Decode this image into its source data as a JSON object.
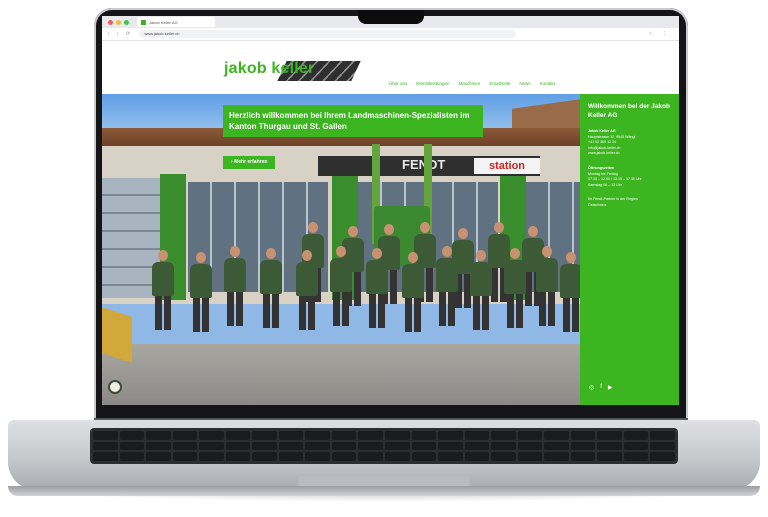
{
  "browser": {
    "tab_title": "Jakob Keller AG",
    "url": "www.jakob-keller.ch",
    "nav_glyphs": "‹ › ⟳",
    "tool_glyphs": "☆ ⋮"
  },
  "logo": {
    "text": "jakob keller"
  },
  "menu": {
    "items": [
      "Über uns",
      "Dienstleistungen",
      "Maschinen",
      "Ersatzteile",
      "News",
      "Kontakt"
    ]
  },
  "hero": {
    "title": "Herzlich willkommen bei Ihrem Landmaschinen-Spezialisten im Kanton Thurgau und St. Gallen",
    "button_label": "Mehr erfahren",
    "sign_brand": "FENDT",
    "sign_station": "station"
  },
  "side_panel": {
    "heading": "Willkommen bei der Jakob Keller AG",
    "contact_title": "Jakob Keller AG",
    "contact_lines": [
      "Hauptstrasse 12, 9545 Wängi",
      "+41 52 369 12 34",
      "info@jakob-keller.ch",
      "www.jakob-keller.ch"
    ],
    "hours_title": "Öffnungszeiten",
    "hours_lines": [
      "Montag bis Freitag",
      "07.30 – 12.00 / 13.15 – 17.30 Uhr",
      "Samstag 08 – 12 Uhr"
    ],
    "note_lines": [
      "Ihr Fendt-Partner in der Region",
      "Ostschweiz"
    ],
    "social_icons": [
      "instagram-icon",
      "facebook-icon",
      "youtube-icon"
    ]
  },
  "colors": {
    "brand_green": "#3cb520",
    "text_on_green": "#ffffff"
  }
}
